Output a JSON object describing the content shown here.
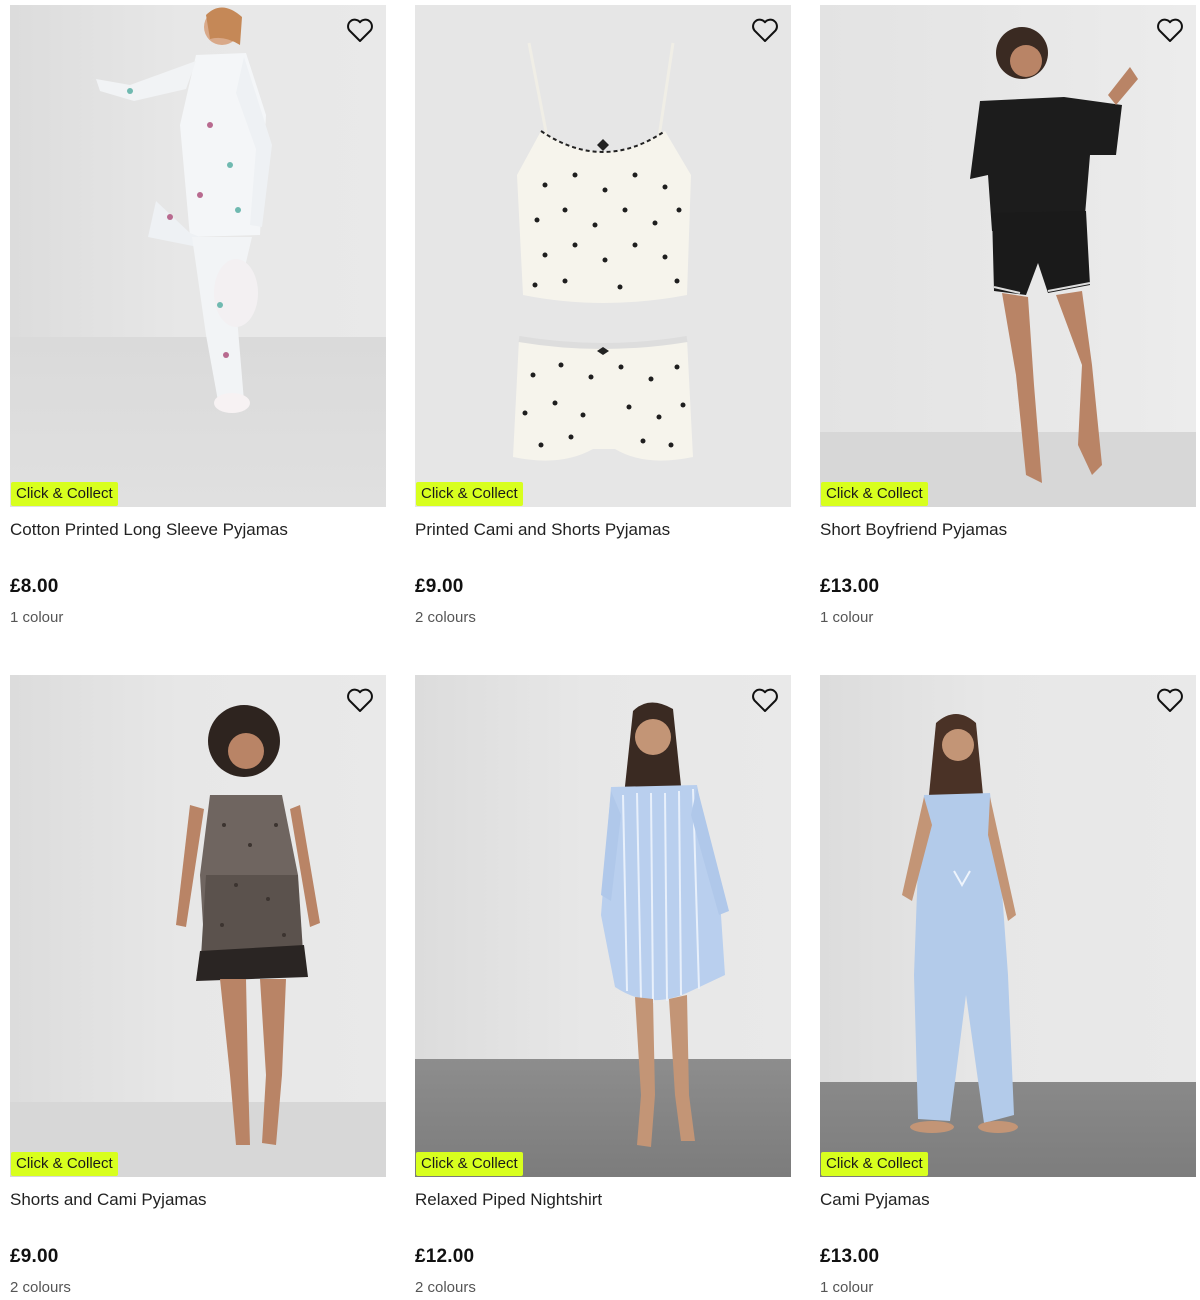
{
  "products": [
    {
      "title": "Cotton Printed Long Sleeve Pyjamas",
      "price": "£8.00",
      "colours": "1 colour",
      "badge": "Click & Collect"
    },
    {
      "title": "Printed Cami and Shorts Pyjamas",
      "price": "£9.00",
      "colours": "2 colours",
      "badge": "Click & Collect"
    },
    {
      "title": "Short Boyfriend Pyjamas",
      "price": "£13.00",
      "colours": "1 colour",
      "badge": "Click & Collect"
    },
    {
      "title": "Shorts and Cami Pyjamas",
      "price": "£9.00",
      "colours": "2 colours",
      "badge": "Click & Collect"
    },
    {
      "title": "Relaxed Piped Nightshirt",
      "price": "£12.00",
      "colours": "2 colours",
      "badge": "Click & Collect"
    },
    {
      "title": "Cami Pyjamas",
      "price": "£13.00",
      "colours": "1 colour",
      "badge": "Click & Collect"
    }
  ],
  "icons": {
    "wishlist": "heart-outline-icon"
  },
  "colors": {
    "badge_bg": "#d8ff1e",
    "text": "#1a1a1a"
  }
}
